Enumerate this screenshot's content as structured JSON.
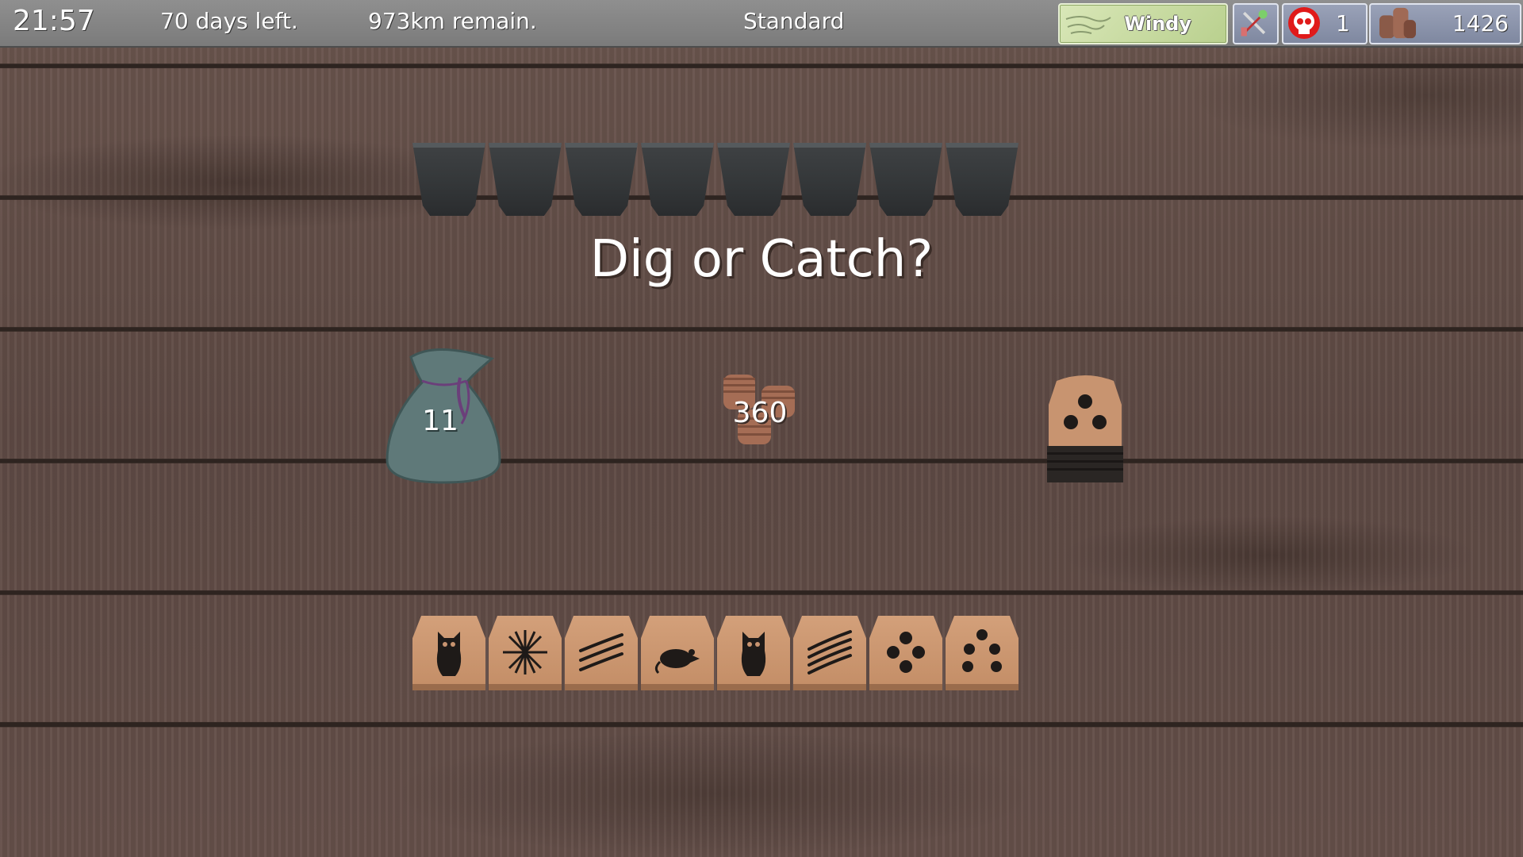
{
  "hud": {
    "clock": "21:57",
    "days_left": "70 days left.",
    "distance": "973km remain.",
    "mode": "Standard",
    "weather": "Windy",
    "weather_icon": "wind-icon",
    "tools_icon": "crossed-tools-icon",
    "skulls": "1",
    "coins": "1426"
  },
  "board": {
    "cup_count": 8,
    "prompt": "Dig or Catch?",
    "bag_count": "11",
    "pot": "360",
    "deck_top": "three-dots"
  },
  "hand": {
    "tiles": [
      "owl",
      "burst",
      "claw-marks",
      "rat",
      "owl",
      "claw-marks",
      "four-dots",
      "five-dots"
    ]
  },
  "colors": {
    "table": "#5f4b45",
    "tile": "#c89470",
    "cup": "#3a3d3f",
    "hud": "#868686",
    "weather_bg": "#c8dca4",
    "badge_bg": "#8c94ac"
  }
}
